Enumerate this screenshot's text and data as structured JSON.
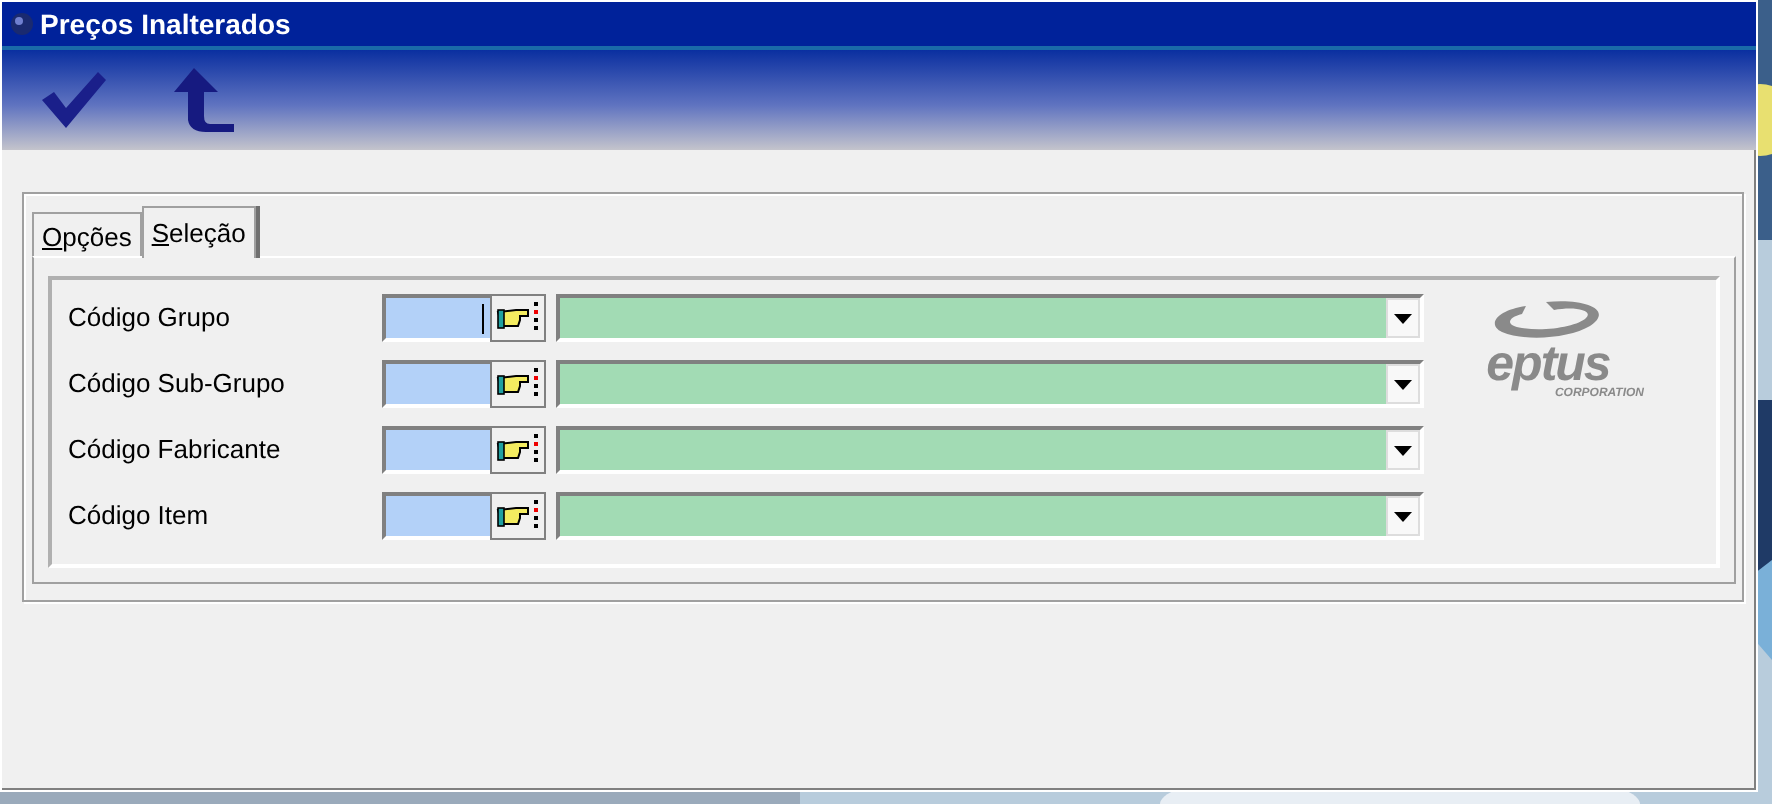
{
  "window": {
    "title": "Preços Inalterados"
  },
  "toolbar": [
    {
      "kind": "confirm"
    },
    {
      "kind": "back"
    }
  ],
  "tabs": [
    {
      "label": "Opções",
      "selected": false
    },
    {
      "label": "Seleção",
      "selected": true
    }
  ],
  "fields": [
    {
      "label": "Código Grupo",
      "focused": true
    },
    {
      "label": "Código Sub-Grupo",
      "focused": false
    },
    {
      "label": "Código Fabricante",
      "focused": false
    },
    {
      "label": "Código Item",
      "focused": false
    }
  ],
  "logo": {
    "name": "eptus",
    "tagline": "CORPORATION"
  }
}
